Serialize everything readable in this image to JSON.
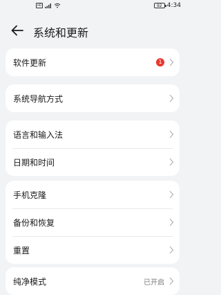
{
  "status_bar": {
    "left_icons": [
      "hd-icon",
      "signal-icon",
      "wifi-icon"
    ],
    "battery": "92",
    "time": "4:34"
  },
  "header": {
    "title": "系统和更新",
    "back_icon": "arrow-left-icon"
  },
  "colors": {
    "background": "#f1f3f5",
    "card": "#ffffff",
    "badge": "#e8382f",
    "secondary_text": "#7a7a7a"
  },
  "cards": [
    {
      "items": [
        {
          "label": "软件更新",
          "badge": "1"
        }
      ]
    },
    {
      "items": [
        {
          "label": "系统导航方式"
        }
      ]
    },
    {
      "items": [
        {
          "label": "语言和输入法"
        },
        {
          "label": "日期和时间"
        }
      ]
    },
    {
      "items": [
        {
          "label": "手机克隆"
        },
        {
          "label": "备份和恢复"
        },
        {
          "label": "重置"
        }
      ]
    },
    {
      "items": [
        {
          "label": "纯净模式",
          "value": "已开启"
        }
      ]
    }
  ]
}
